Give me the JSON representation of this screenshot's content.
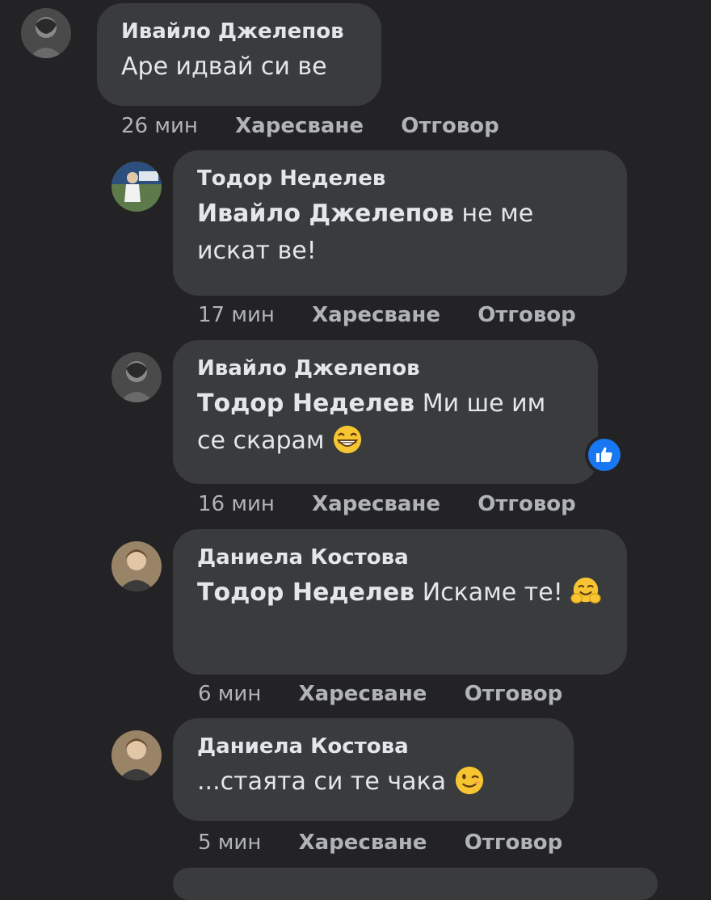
{
  "actions": {
    "like_label": "Харесване",
    "reply_label": "Отговор"
  },
  "comments": [
    {
      "author": "Ивайло Джелепов",
      "mention": "",
      "text": "Аре идвай си ве",
      "time": "26 мин",
      "emoji": ""
    },
    {
      "author": "Тодор Неделев",
      "mention": "Ивайло Джелепов",
      "text": "не ме искат ве!",
      "time": "17 мин",
      "emoji": ""
    },
    {
      "author": "Ивайло Джелепов",
      "mention": "Тодор Неделев",
      "text": "Ми ше им се скарам",
      "time": "16 мин",
      "emoji": "grinning-face-icon",
      "reaction": "like-icon"
    },
    {
      "author": "Даниела Костова",
      "mention": "Тодор Неделев",
      "text": "Искаме те!",
      "time": "6 мин",
      "emoji": "hugging-face-icon"
    },
    {
      "author": "Даниела Костова",
      "mention": "",
      "text": "...стаята си те чака",
      "time": "5 мин",
      "emoji": "winking-face-icon"
    }
  ],
  "colors": {
    "background": "#232325",
    "bubble": "#3a3b3c",
    "text": "#e4e6eb",
    "meta": "#b0b3b8",
    "like_blue": "#1877f2"
  }
}
